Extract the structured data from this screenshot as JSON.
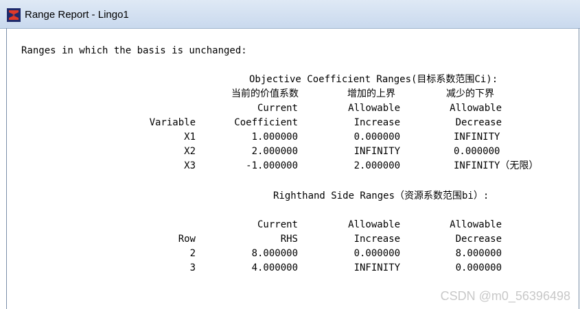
{
  "window": {
    "title": "Range Report - Lingo1"
  },
  "report": {
    "intro": "Ranges in which the basis is unchanged:",
    "objective": {
      "heading": "Objective Coefficient Ranges(目标系数范围Ci):",
      "cn_headers": [
        "当前的价值系数",
        "增加的上界",
        "减少的下界"
      ],
      "header_row1": [
        "Current",
        "Allowable",
        "Allowable"
      ],
      "header_row2": [
        "Variable",
        "Coefficient",
        "Increase",
        "Decrease"
      ],
      "rows": [
        [
          "X1",
          "1.000000",
          "0.000000",
          "INFINITY"
        ],
        [
          "X2",
          "2.000000",
          "INFINITY",
          "0.000000"
        ],
        [
          "X3",
          "-1.000000",
          "2.000000",
          "INFINITY（无限）"
        ]
      ]
    },
    "rhs": {
      "heading": "Righthand Side Ranges（资源系数范围bi）:",
      "header_row1": [
        "Current",
        "Allowable",
        "Allowable"
      ],
      "header_row2": [
        "Row",
        "RHS",
        "Increase",
        "Decrease"
      ],
      "rows": [
        [
          "2",
          "8.000000",
          "0.000000",
          "8.000000"
        ],
        [
          "3",
          "4.000000",
          "INFINITY",
          "0.000000"
        ]
      ]
    }
  },
  "watermark": "CSDN @m0_56396498"
}
